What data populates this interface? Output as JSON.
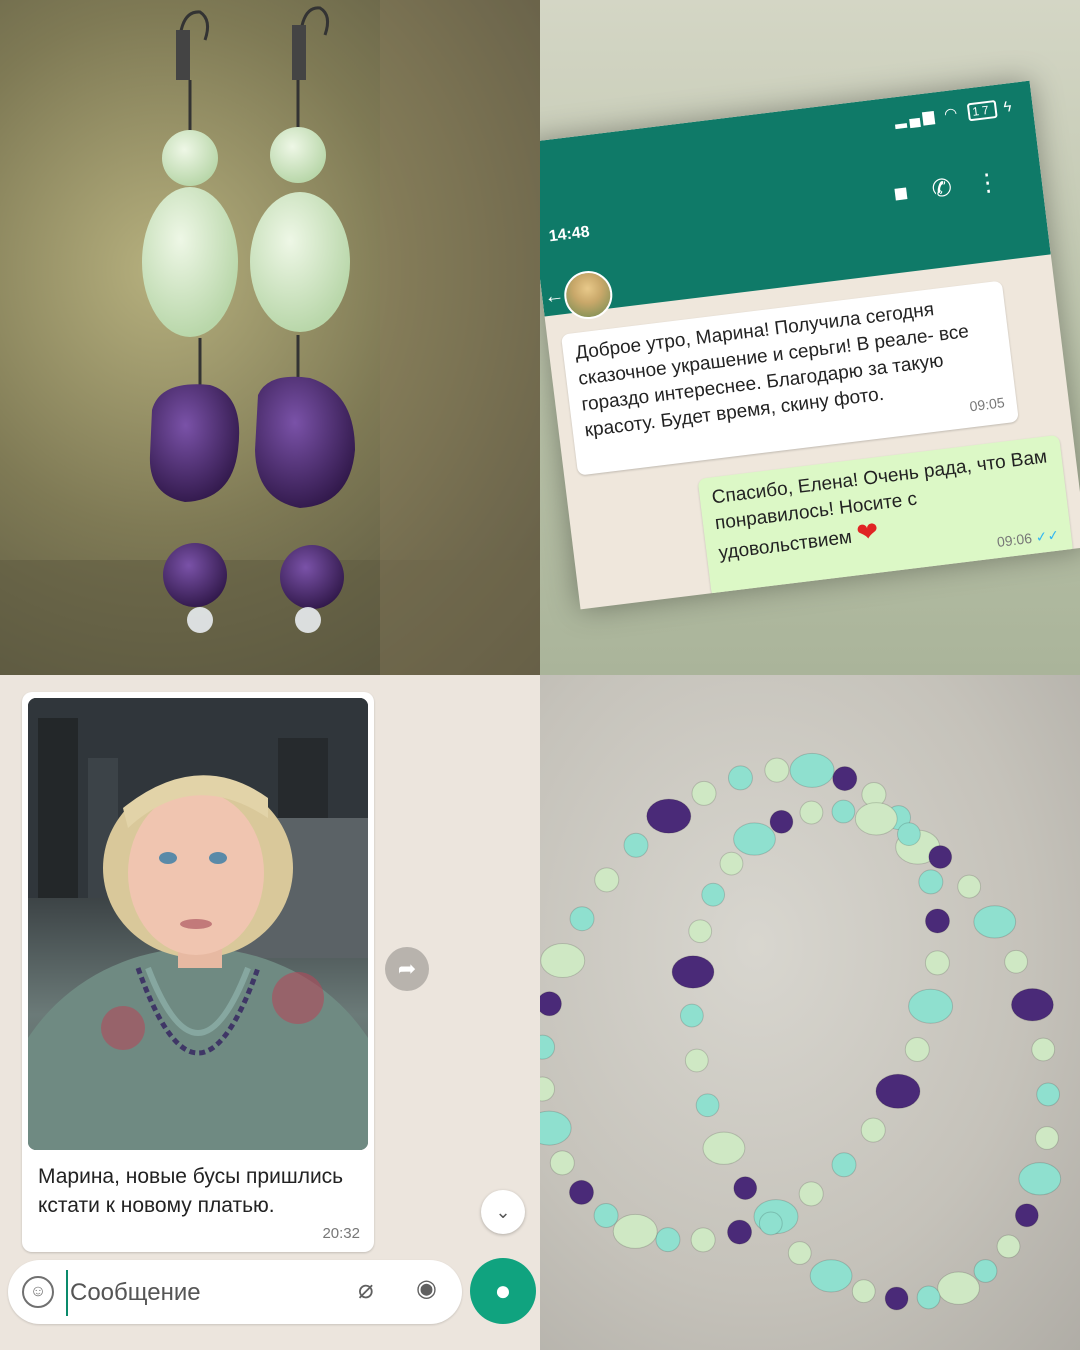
{
  "chat_top": {
    "status_time": "14:48",
    "battery": "17",
    "incoming_message": {
      "text": "Доброе утро, Марина! Получила сегодня сказочное украшение и серьги! В реале- все гораздо интереснее. Благодарю за такую красоту. Будет время, скину фото.",
      "time": "09:05"
    },
    "outgoing_message": {
      "text": "Спасибо, Елена! Очень рада, что Вам понравилось! Носите с удовольствием",
      "heart": "❤",
      "time": "09:06",
      "ticks": "✓✓"
    }
  },
  "chat_bottom": {
    "caption": "Марина, новые бусы пришлись кстати к новому платью.",
    "time": "20:32",
    "input_placeholder": "Сообщение"
  },
  "colors": {
    "header_green": "#0f7a68",
    "outgoing_bubble": "#dcf8c6",
    "mic_button": "#10a37f",
    "amethyst": "#4a2a78",
    "jade": "#cfe8c4",
    "aqua_bead": "#8fe0cf"
  },
  "icons": [
    "video-call-icon",
    "phone-icon",
    "menu-icon",
    "forward-icon",
    "scroll-down-icon",
    "emoji-icon",
    "attach-icon",
    "camera-icon",
    "mic-icon"
  ]
}
